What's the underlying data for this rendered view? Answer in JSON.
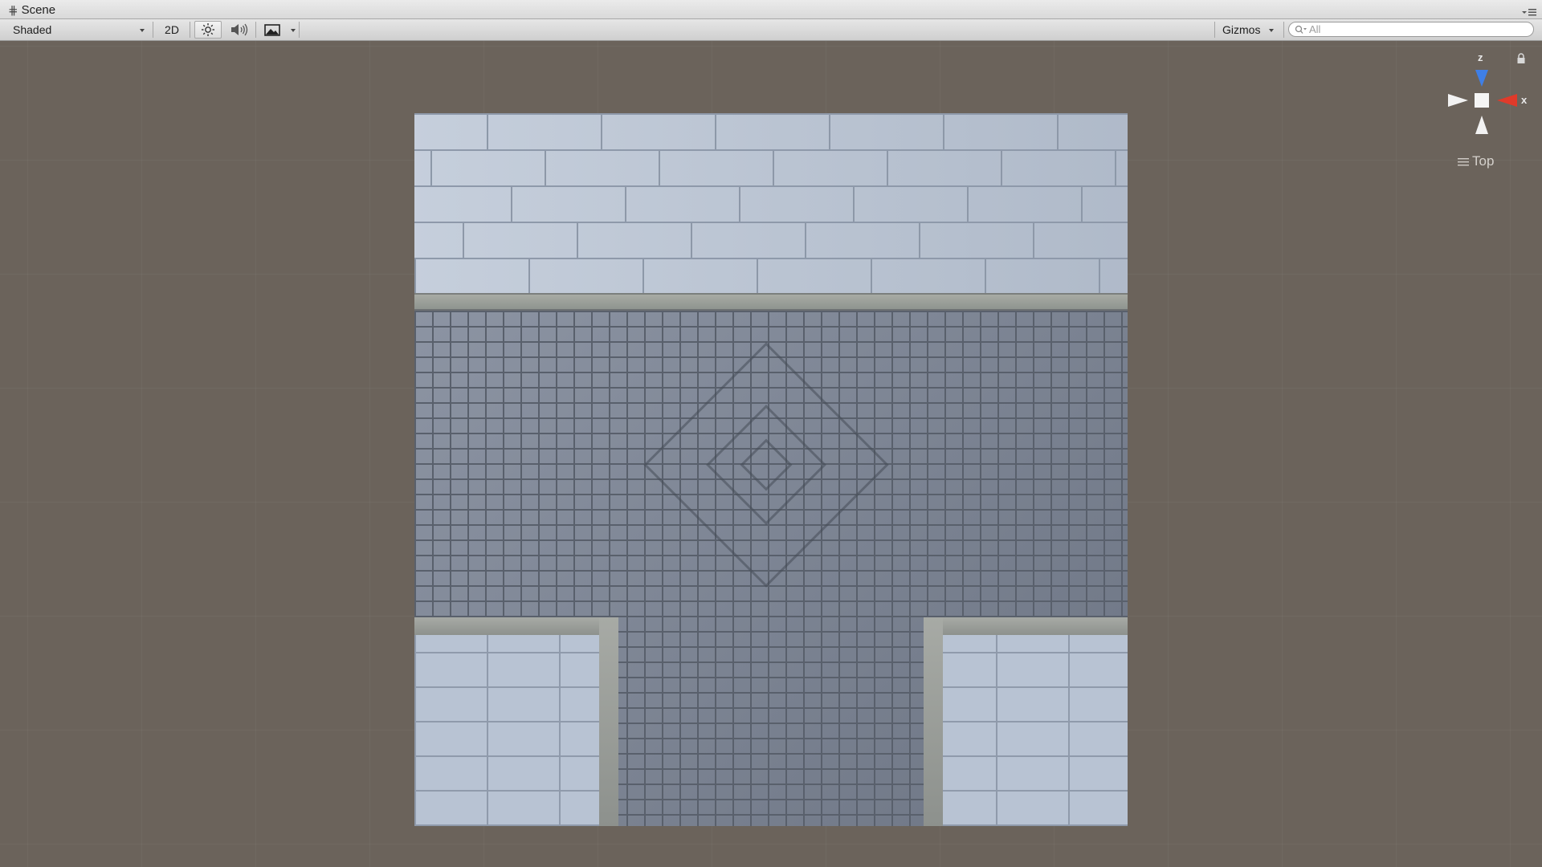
{
  "window": {
    "tab_title": "Scene",
    "tab_icon": "scene-grid-icon"
  },
  "toolbar": {
    "draw_mode": "Shaded",
    "btn_2d": "2D",
    "lighting_icon": "sun-icon",
    "audio_icon": "speaker-icon",
    "effects_icon": "image-icon",
    "gizmos_label": "Gizmos",
    "search_placeholder": "All"
  },
  "scene": {
    "gizmo": {
      "axis_y_label": "z",
      "axis_x_label": "x",
      "view_label": "Top",
      "colors": {
        "z_axis": "#3f7fe6",
        "x_axis": "#e03a2a",
        "neutral": "#f2f2f2"
      }
    },
    "texture": "stone-tileset"
  }
}
